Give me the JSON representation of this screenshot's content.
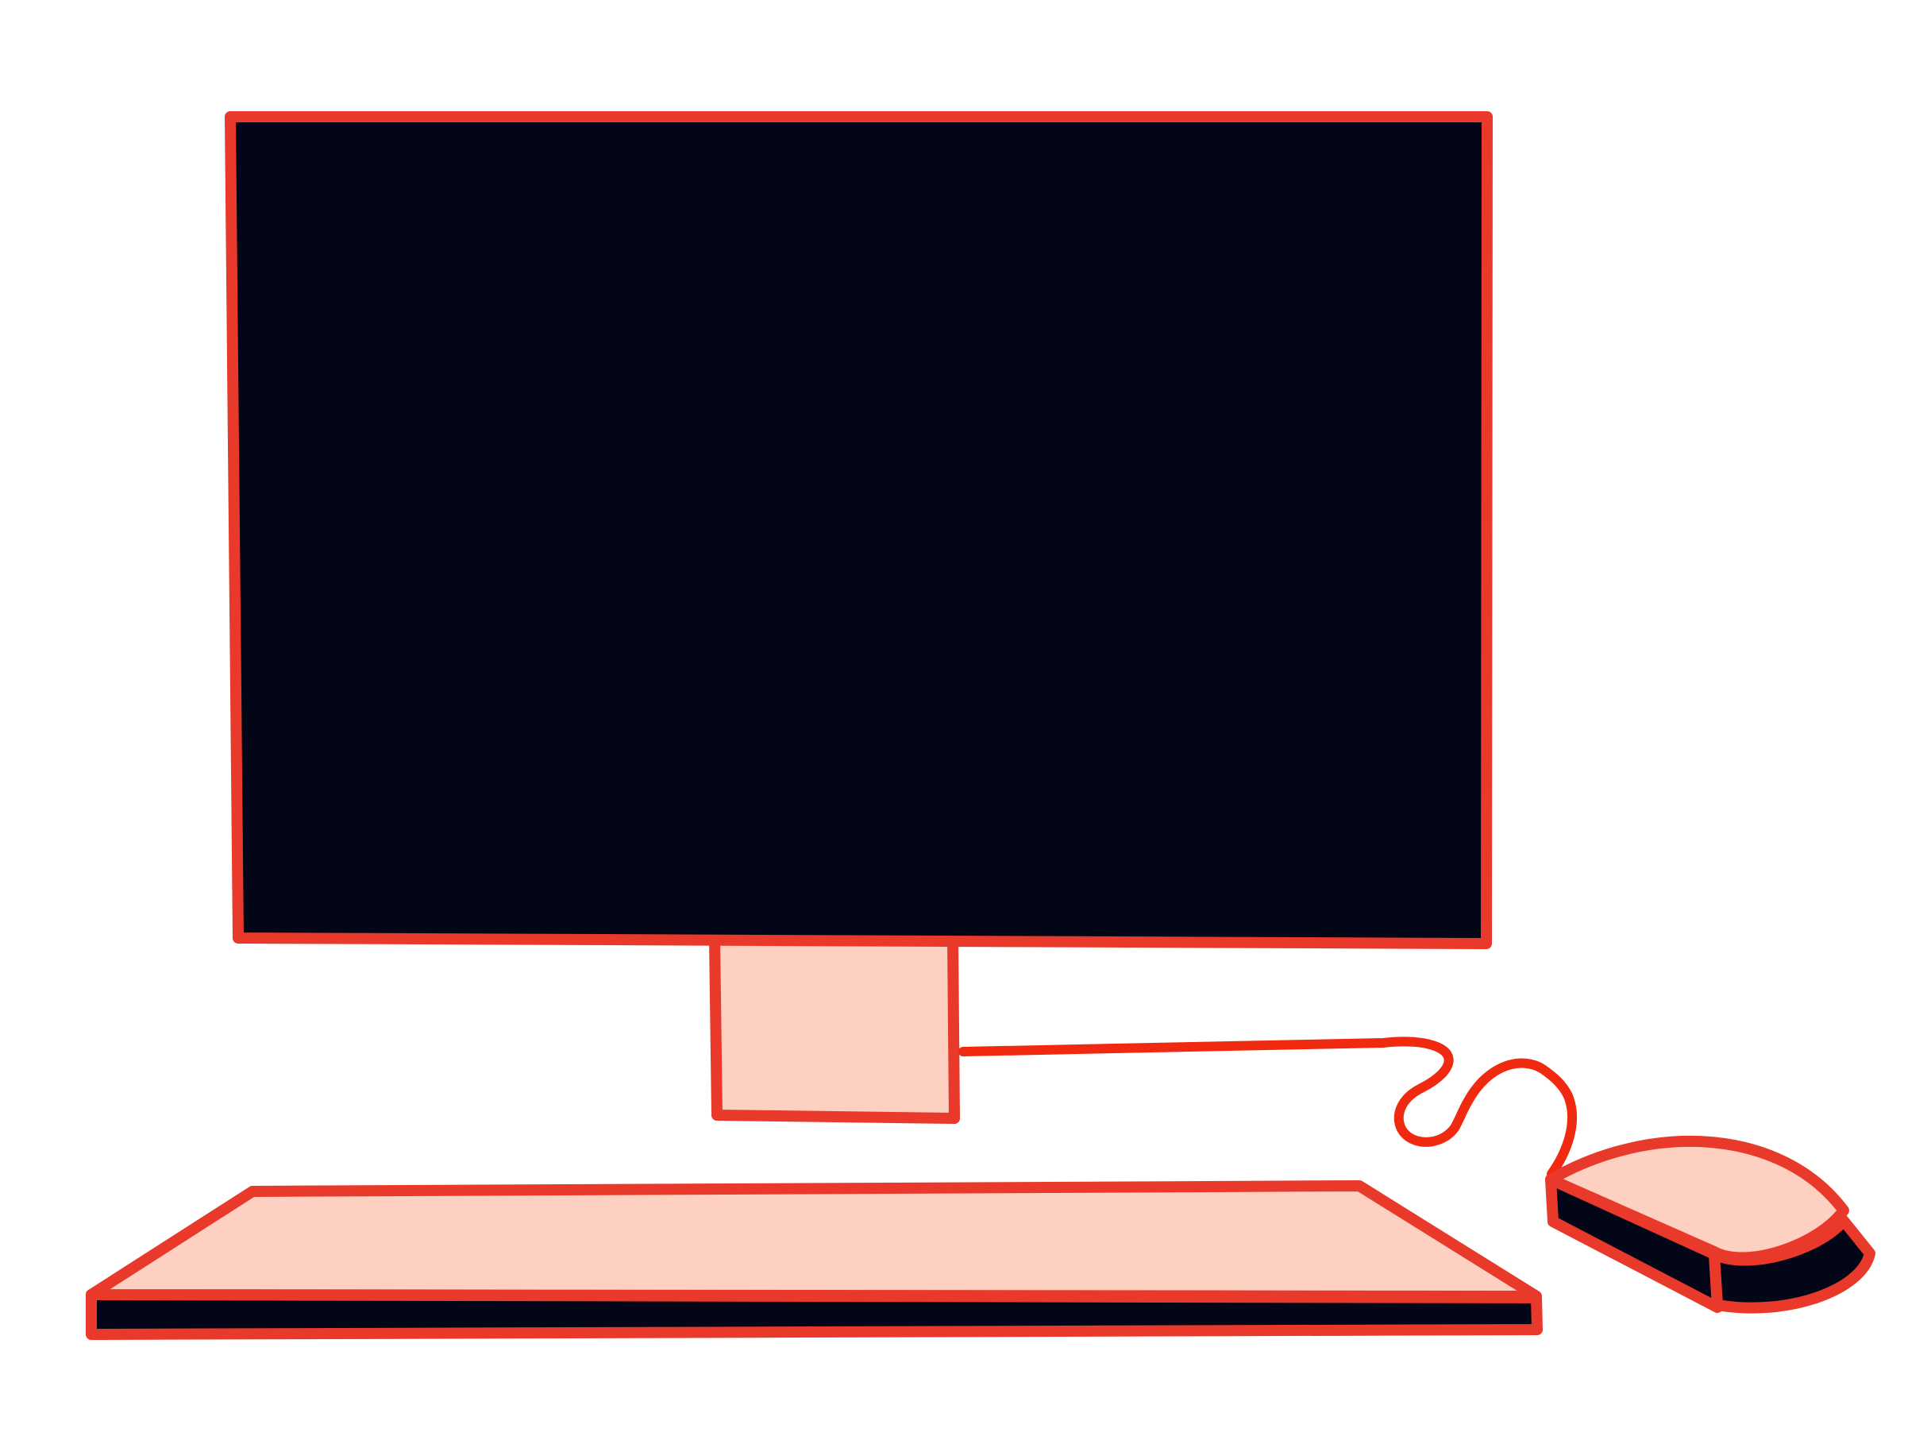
{
  "illustration": {
    "subject": "desktop-computer",
    "components": [
      "monitor",
      "monitor-stand",
      "cable",
      "keyboard",
      "mouse"
    ]
  },
  "colors": {
    "background": "#ffffff",
    "outline": "#e8392a",
    "cable": "#f02a10",
    "screen": "#030617",
    "fill_light": "#fdd0c2",
    "fill_dark": "#030617"
  }
}
